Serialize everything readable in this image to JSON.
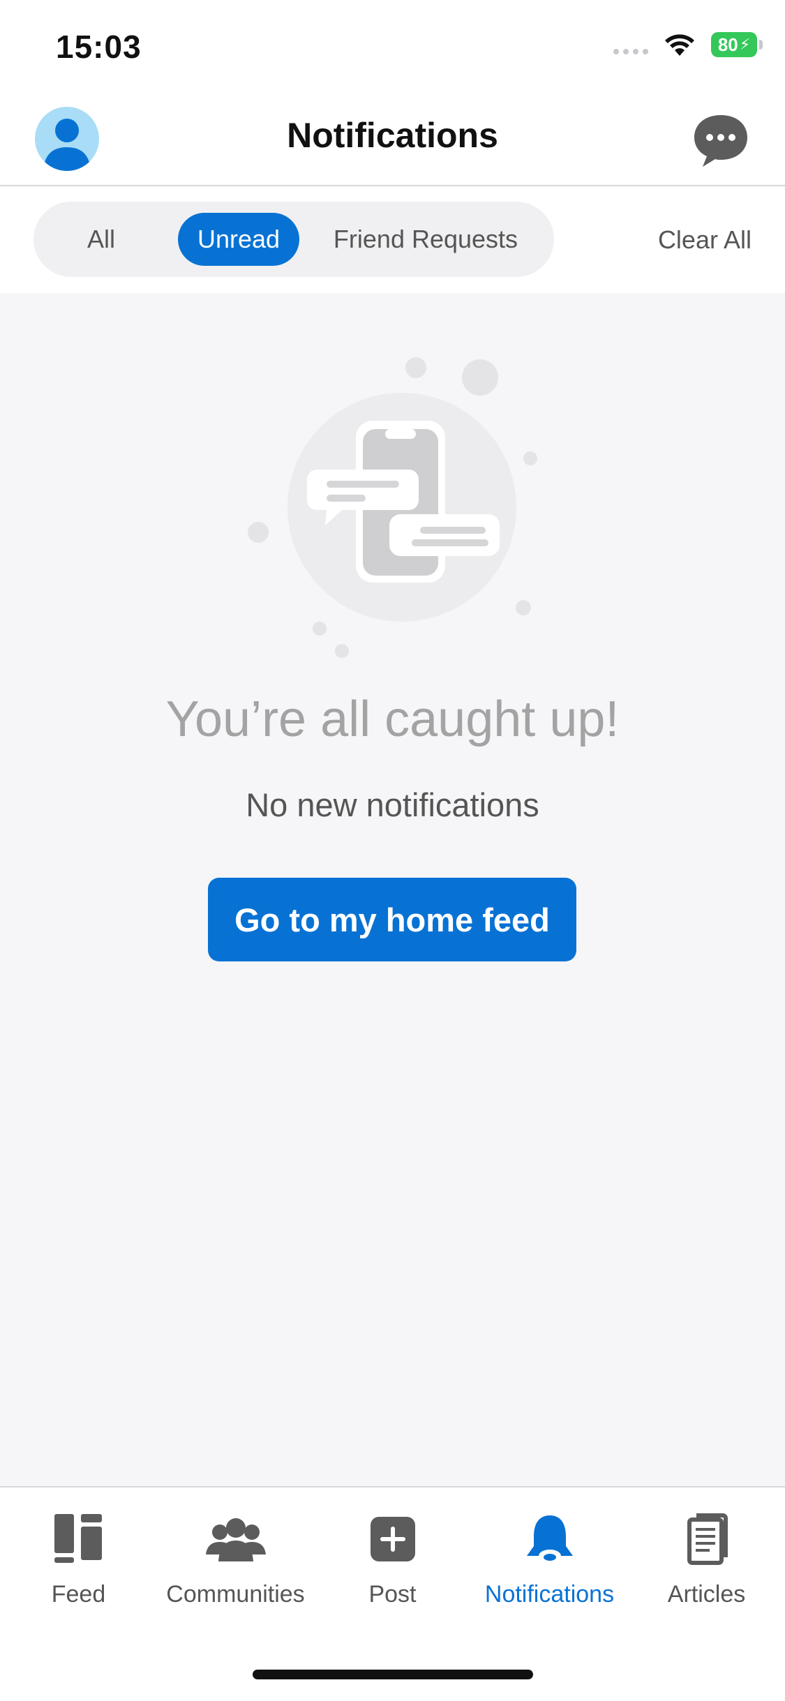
{
  "status_bar": {
    "time": "15:03",
    "battery_level": "80",
    "battery_color": "#34c759",
    "icons": [
      "signal-dots-icon",
      "wifi-icon",
      "battery-charging-icon"
    ]
  },
  "header": {
    "title": "Notifications",
    "left_icon": "user-avatar-icon",
    "right_icon": "chat-bubble-icon"
  },
  "filters": {
    "tabs": [
      {
        "label": "All",
        "selected": false
      },
      {
        "label": "Unread",
        "selected": true
      },
      {
        "label": "Friend Requests",
        "selected": false
      }
    ],
    "clear_all": "Clear All"
  },
  "empty_state": {
    "illustration": "phone-chat-bubbles-icon",
    "title": "You’re all caught up!",
    "subtitle": "No new notifications",
    "cta": "Go to my home feed"
  },
  "tab_bar": {
    "items": [
      {
        "label": "Feed",
        "icon": "feed-icon",
        "active": false
      },
      {
        "label": "Communities",
        "icon": "communities-icon",
        "active": false
      },
      {
        "label": "Post",
        "icon": "post-plus-icon",
        "active": false
      },
      {
        "label": "Notifications",
        "icon": "bell-icon",
        "active": true
      },
      {
        "label": "Articles",
        "icon": "articles-icon",
        "active": false
      }
    ]
  },
  "colors": {
    "accent": "#0872d4",
    "background": "#f6f6f8",
    "muted_text": "#a3a3a3"
  }
}
